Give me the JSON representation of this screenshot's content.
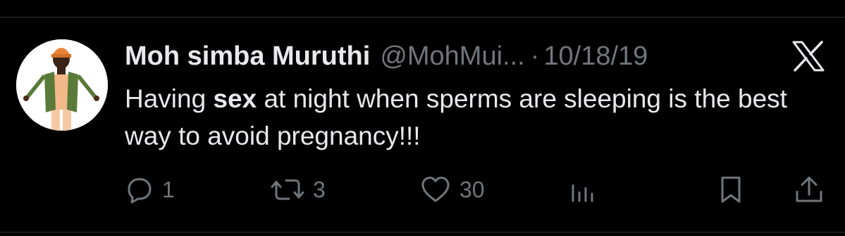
{
  "tweet": {
    "author": {
      "display_name": "Moh simba Muruthi",
      "handle": "@MohMui...",
      "separator": "·",
      "date": "10/18/19"
    },
    "text_parts": {
      "before": "Having ",
      "bold": "sex",
      "after": " at night when sperms are sleeping is the best way to avoid pregnancy!!!"
    },
    "metrics": {
      "replies": "1",
      "reposts": "3",
      "likes": "30"
    },
    "icons": {
      "reply": "reply-bubble-icon",
      "repost": "repost-arrows-icon",
      "like": "heart-icon",
      "views": "bar-chart-icon",
      "bookmark": "bookmark-icon",
      "share": "share-upload-icon",
      "platform": "x-logo-icon"
    }
  },
  "colors": {
    "background": "#000000",
    "primary_text": "#e7e9ea",
    "secondary_text": "#71767b",
    "divider": "#2f3336"
  }
}
